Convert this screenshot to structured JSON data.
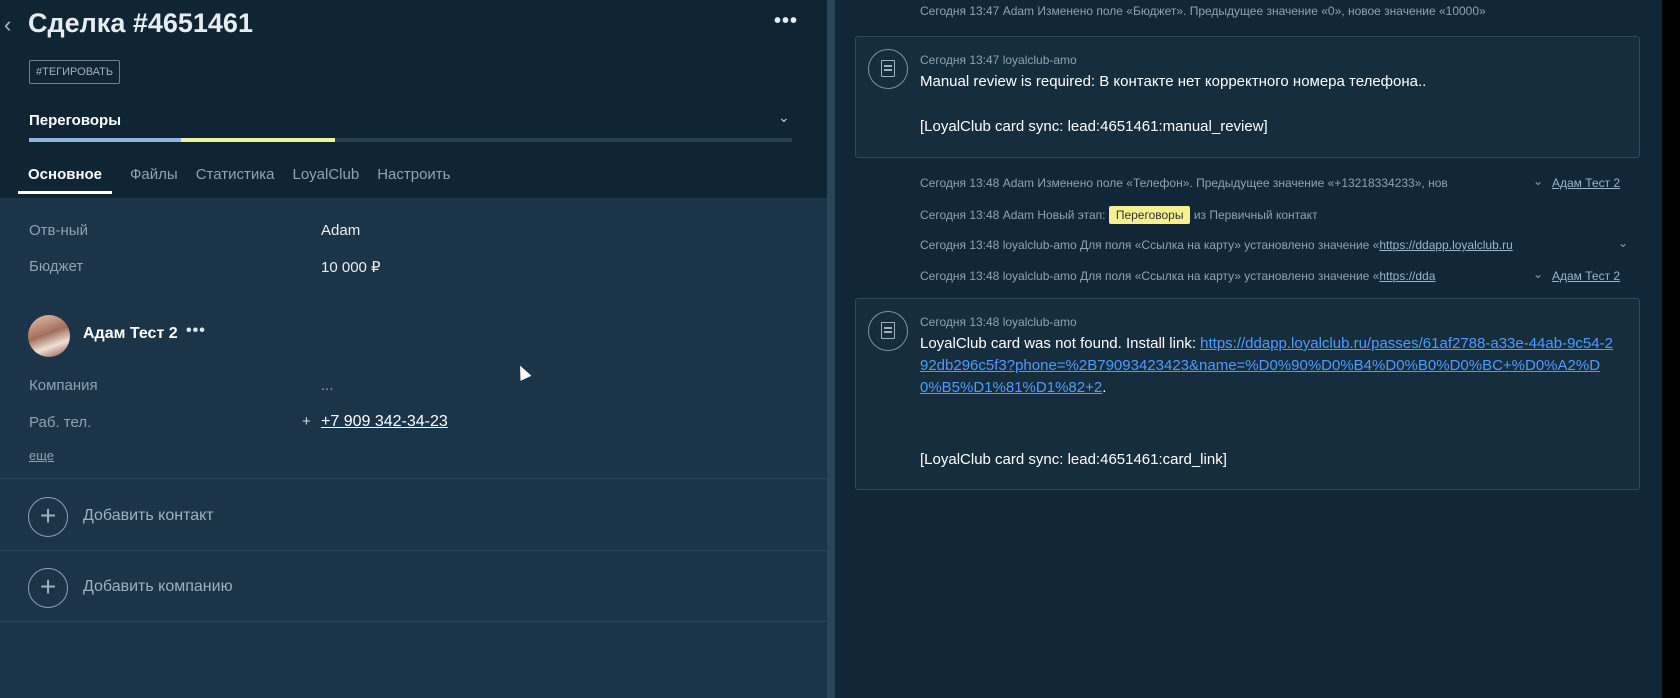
{
  "header": {
    "title": "Сделка #4651461",
    "tag": "#ТЕГИРОВАТЬ",
    "stage": "Переговоры"
  },
  "tabs": [
    "Основное",
    "Файлы",
    "Статистика",
    "LoyalClub",
    "Настроить"
  ],
  "fields": [
    {
      "label": "Отв-ный",
      "value": "Adam"
    },
    {
      "label": "Бюджет",
      "value": "10 000 ₽"
    }
  ],
  "contact": {
    "name": "Адам Тест 2",
    "company_label": "Компания",
    "company_value": "...",
    "phone_label": "Раб. тел.",
    "phone_value": "+7 909 342-34-23",
    "more_link": "еще"
  },
  "actions": {
    "add_contact": "Добавить контакт",
    "add_company": "Добавить компанию"
  },
  "feed": {
    "log_top": "Сегодня 13:47 Adam Изменено поле «Бюджет». Предыдущее значение «0», новое значение «10000»",
    "card1": {
      "meta": "Сегодня 13:47 loyalclub-amo",
      "line1": "Manual review is required: В контакте нет корректного номера телефона..",
      "line2": "[LoyalClub card sync: lead:4651461:manual_review]"
    },
    "logs": [
      {
        "text": "Сегодня 13:48 Adam Изменено поле «Телефон». Предыдущее значение «+13218334233», нов",
        "link": "Адам Тест 2"
      },
      {
        "text_before": "Сегодня 13:48 Adam Новый этап:",
        "highlight": "Переговоры",
        "text_after": "из Первичный контакт"
      },
      {
        "text": "Сегодня 13:48 loyalclub-amo Для поля «Ссылка на карту» установлено значение «",
        "link": "https://ddapp.loyalclub.ru"
      },
      {
        "text": "Сегодня 13:48 loyalclub-amo Для поля «Ссылка на карту» установлено значение «",
        "link": "https://dda",
        "link2": "Адам Тест 2"
      }
    ],
    "card2": {
      "meta": "Сегодня 13:48 loyalclub-amo",
      "prefix": "LoyalClub card was not found. Install link: ",
      "url": "https://ddapp.loyalclub.ru/passes/61af2788-a33e-44ab-9c54-292db296c5f3?phone=%2B79093423423&name=%D0%90%D0%B4%D0%B0%D0%BC+%D0%A2%D0%B5%D1%81%D1%82+2",
      "suffix": ".",
      "line2": "[LoyalClub card sync: lead:4651461:card_link]"
    }
  }
}
